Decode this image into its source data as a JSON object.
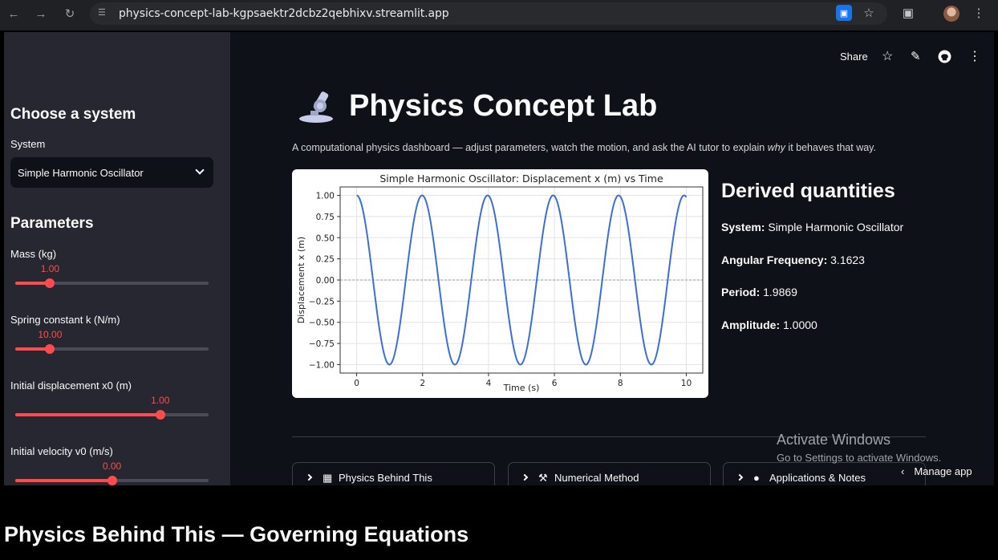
{
  "browser": {
    "url": "physics-concept-lab-kgpsaektr2dcbz2qebhixv.streamlit.app"
  },
  "sidebar": {
    "heading": "Choose a system",
    "system_label": "System",
    "system_value": "Simple Harmonic Oscillator",
    "params_heading": "Parameters",
    "params": [
      {
        "label": "Mass (kg)",
        "value": "1.00",
        "fraction": 0.18
      },
      {
        "label": "Spring constant k (N/m)",
        "value": "10.00",
        "fraction": 0.18
      },
      {
        "label": "Initial displacement x0 (m)",
        "value": "1.00",
        "fraction": 0.75
      },
      {
        "label": "Initial velocity v0 (m/s)",
        "value": "0.00",
        "fraction": 0.5
      }
    ]
  },
  "toolbar": {
    "share": "Share"
  },
  "header": {
    "title": "Physics Concept Lab",
    "subtitle_pre": "A computational physics dashboard — adjust parameters, watch the motion, and ask the AI tutor to explain ",
    "subtitle_em": "why",
    "subtitle_post": " it behaves that way."
  },
  "derived": {
    "heading": "Derived quantities",
    "items": [
      {
        "key": "System:",
        "value": "Simple Harmonic Oscillator"
      },
      {
        "key": "Angular Frequency:",
        "value": "3.1623"
      },
      {
        "key": "Period:",
        "value": "1.9869"
      },
      {
        "key": "Amplitude:",
        "value": "1.0000"
      }
    ]
  },
  "expanders": [
    {
      "label": "Physics Behind This",
      "icon": "books-icon"
    },
    {
      "label": "Numerical Method",
      "icon": "wrench-icon"
    },
    {
      "label": "Applications & Notes",
      "icon": "globe-icon"
    }
  ],
  "overlay": {
    "activate_title": "Activate Windows",
    "activate_sub": "Go to Settings to activate Windows.",
    "manage_app": "Manage app"
  },
  "bottom_heading": "Physics Behind This — Governing Equations",
  "chart_data": {
    "type": "line",
    "title": "Simple Harmonic Oscillator: Displacement x (m) vs Time",
    "xlabel": "Time (s)",
    "ylabel": "Displacement x (m)",
    "xlim": [
      -0.5,
      10.5
    ],
    "ylim": [
      -1.1,
      1.1
    ],
    "xticks": [
      "0",
      "2",
      "4",
      "6",
      "8",
      "10"
    ],
    "yticks": [
      "1.00",
      "0.75",
      "0.50",
      "0.25",
      "0.00",
      "−0.25",
      "−0.50",
      "−0.75",
      "−1.00"
    ],
    "grid": true,
    "series": [
      {
        "amplitude": 1.0,
        "angular_frequency": 3.1623,
        "t_start": 0,
        "t_end": 10,
        "color": "#3a6fd6"
      }
    ],
    "reference_line_y": 0
  }
}
